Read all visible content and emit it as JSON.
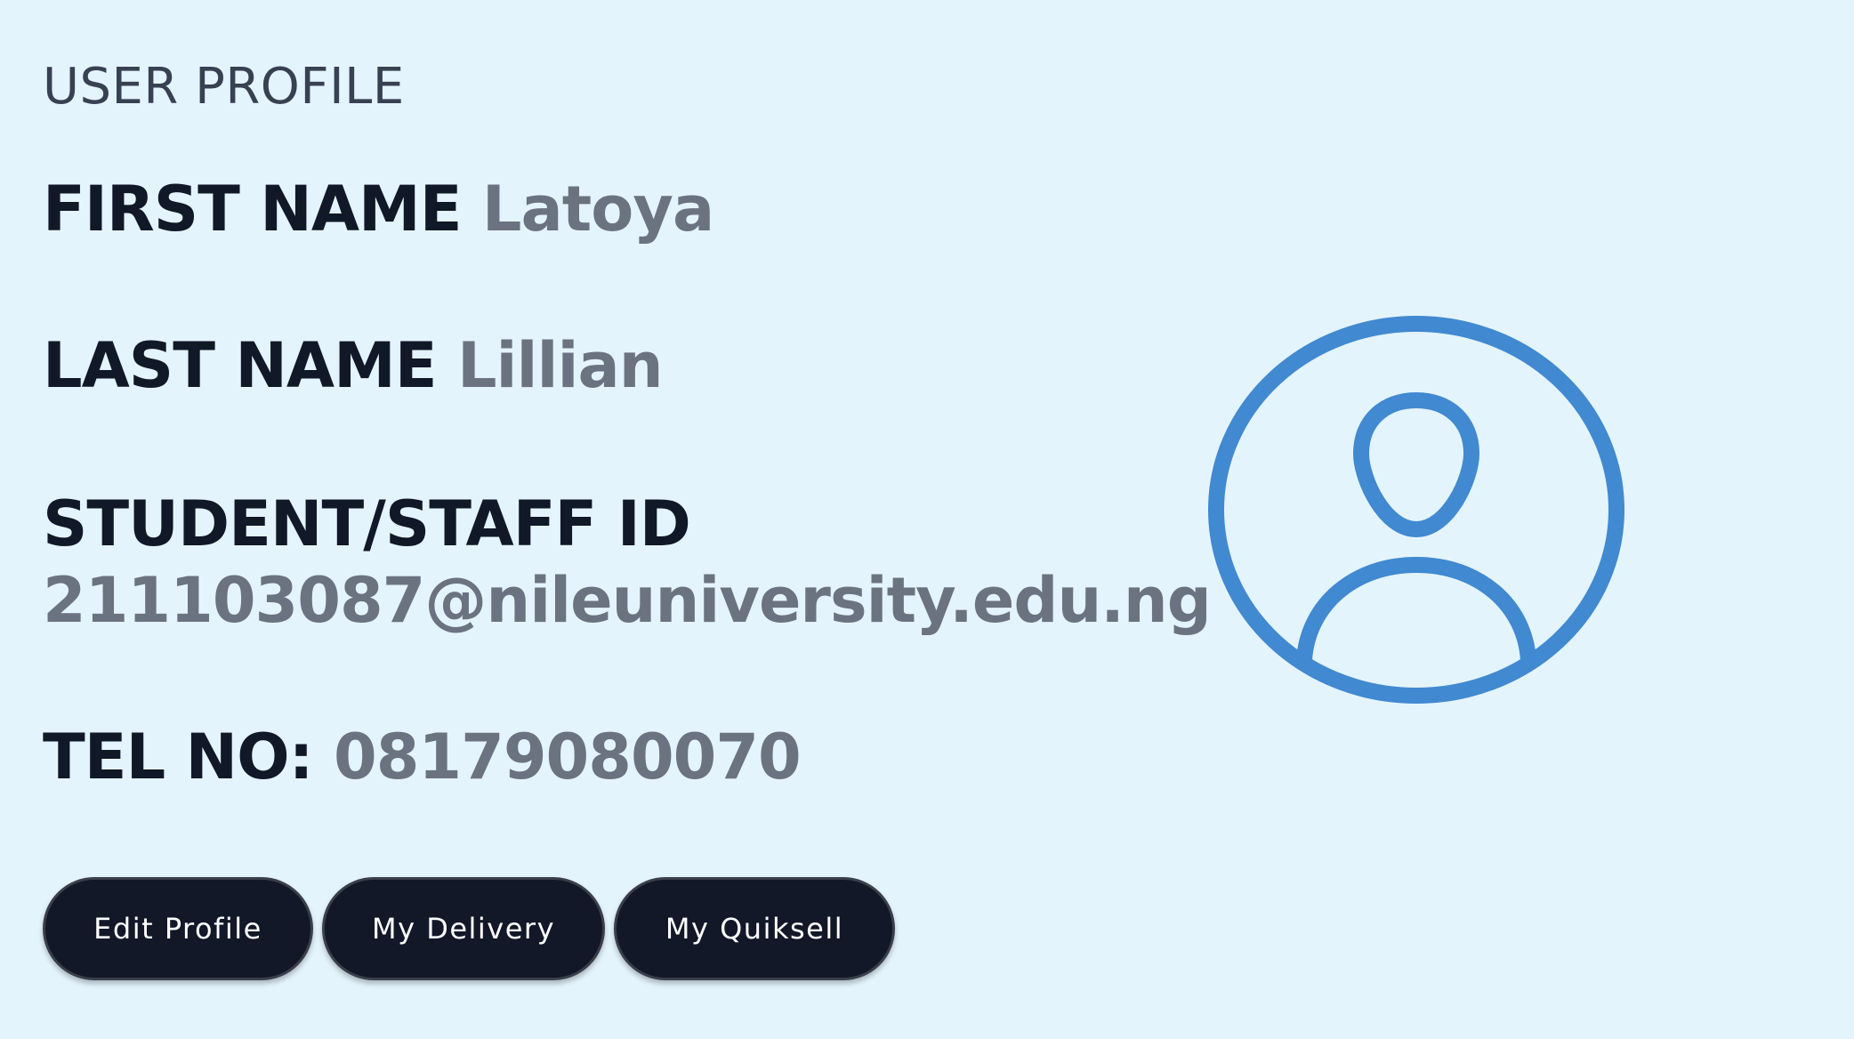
{
  "profile": {
    "heading": "USER PROFILE",
    "first_name_label": "FIRST NAME",
    "first_name_value": "Latoya",
    "last_name_label": "LAST NAME",
    "last_name_value": "Lillian",
    "id_label": "STUDENT/STAFF ID",
    "id_value": "211103087@nileuniversity.edu.ng",
    "tel_label": "TEL NO:",
    "tel_value": "08179080070"
  },
  "actions": {
    "edit_label": "Edit Profile",
    "delivery_label": "My Delivery",
    "quiksell_label": "My Quiksell"
  },
  "avatar": {
    "icon": "user-circle-icon",
    "color": "#4189d1"
  },
  "colors": {
    "background": "#e4f4fd",
    "label": "#111827",
    "value": "#6b7280",
    "button": "#121828"
  }
}
